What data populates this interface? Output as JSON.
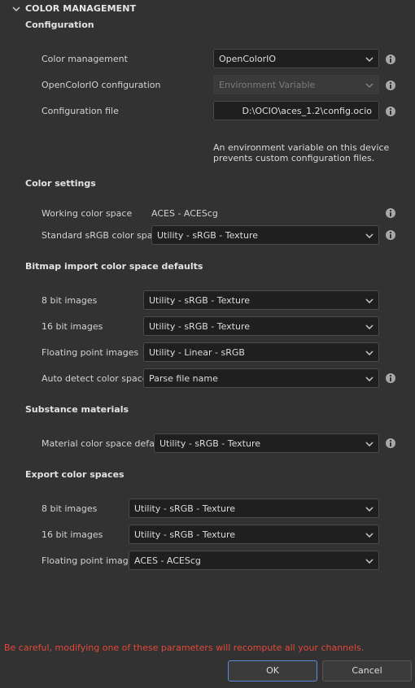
{
  "section": {
    "title": "COLOR MANAGEMENT"
  },
  "configuration": {
    "title": "Configuration",
    "color_management": {
      "label": "Color management",
      "value": "OpenColorIO"
    },
    "ocio_configuration": {
      "label": "OpenColorIO configuration",
      "value": "Environment Variable"
    },
    "configuration_file": {
      "label": "Configuration file",
      "value": "D:\\OCIO\\aces_1.2\\config.ocio"
    },
    "note": "An environment variable on this device prevents custom configuration files."
  },
  "color_settings": {
    "title": "Color settings",
    "working_space": {
      "label": "Working color space",
      "value": "ACES - ACEScg"
    },
    "standard_srgb": {
      "label": "Standard sRGB color space",
      "value": "Utility - sRGB - Texture"
    }
  },
  "bitmap_import": {
    "title": "Bitmap import color space defaults",
    "bit8": {
      "label": "8 bit images",
      "value": "Utility - sRGB - Texture"
    },
    "bit16": {
      "label": "16 bit images",
      "value": "Utility - sRGB - Texture"
    },
    "floating": {
      "label": "Floating point images",
      "value": "Utility - Linear - sRGB"
    },
    "auto_detect": {
      "label": "Auto detect color spaces",
      "value": "Parse file name"
    }
  },
  "substance_materials": {
    "title": "Substance materials",
    "material_default": {
      "label": "Material color space default",
      "value": "Utility - sRGB - Texture"
    }
  },
  "export": {
    "title": "Export color spaces",
    "bit8": {
      "label": "8 bit images",
      "value": "Utility - sRGB - Texture"
    },
    "bit16": {
      "label": "16 bit images",
      "value": "Utility - sRGB - Texture"
    },
    "floating": {
      "label": "Floating point images",
      "value": "ACES - ACEScg"
    }
  },
  "footer": {
    "warning": "Be careful, modifying one of these parameters will recompute all your channels.",
    "ok_label": "OK",
    "cancel_label": "Cancel"
  },
  "colors": {
    "background": "#323232",
    "field_background": "#1f1f1f",
    "warning_text": "#e2483a",
    "ok_border": "#5b8ed6"
  }
}
